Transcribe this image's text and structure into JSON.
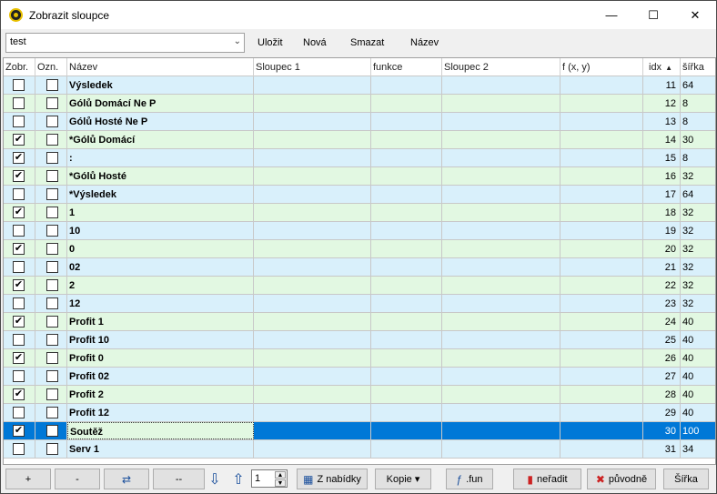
{
  "window": {
    "title": "Zobrazit sloupce",
    "minimize": "—",
    "maximize": "☐",
    "close": "✕"
  },
  "toolbar": {
    "combo_value": "test",
    "save_label": "Uložit",
    "new_label": "Nová",
    "delete_label": "Smazat",
    "name_label": "Název"
  },
  "grid": {
    "columns": [
      "Zobr.",
      "Ozn.",
      "Název",
      "Sloupec 1",
      "funkce",
      "Sloupec 2",
      "f (x, y)",
      "idx",
      "šířka"
    ],
    "sort_indicator": "▲",
    "rows": [
      {
        "show": false,
        "mark": false,
        "name": "Výsledek",
        "idx": "11",
        "width": "64"
      },
      {
        "show": false,
        "mark": false,
        "name": "Gólů Domácí Ne P",
        "idx": "12",
        "width": "8"
      },
      {
        "show": false,
        "mark": false,
        "name": "Gólů Hosté Ne P",
        "idx": "13",
        "width": "8"
      },
      {
        "show": true,
        "mark": false,
        "name": "*Gólů Domácí",
        "idx": "14",
        "width": "30"
      },
      {
        "show": true,
        "mark": false,
        "name": ":",
        "idx": "15",
        "width": "8"
      },
      {
        "show": true,
        "mark": false,
        "name": "*Gólů Hosté",
        "idx": "16",
        "width": "32"
      },
      {
        "show": false,
        "mark": false,
        "name": "*Výsledek",
        "idx": "17",
        "width": "64"
      },
      {
        "show": true,
        "mark": false,
        "name": "1",
        "idx": "18",
        "width": "32"
      },
      {
        "show": false,
        "mark": false,
        "name": "10",
        "idx": "19",
        "width": "32"
      },
      {
        "show": true,
        "mark": false,
        "name": "0",
        "idx": "20",
        "width": "32"
      },
      {
        "show": false,
        "mark": false,
        "name": "02",
        "idx": "21",
        "width": "32"
      },
      {
        "show": true,
        "mark": false,
        "name": "2",
        "idx": "22",
        "width": "32"
      },
      {
        "show": false,
        "mark": false,
        "name": "12",
        "idx": "23",
        "width": "32"
      },
      {
        "show": true,
        "mark": false,
        "name": "Profit 1",
        "idx": "24",
        "width": "40"
      },
      {
        "show": false,
        "mark": false,
        "name": "Profit 10",
        "idx": "25",
        "width": "40"
      },
      {
        "show": true,
        "mark": false,
        "name": "Profit 0",
        "idx": "26",
        "width": "40"
      },
      {
        "show": false,
        "mark": false,
        "name": "Profit 02",
        "idx": "27",
        "width": "40"
      },
      {
        "show": true,
        "mark": false,
        "name": "Profit 2",
        "idx": "28",
        "width": "40"
      },
      {
        "show": false,
        "mark": false,
        "name": "Profit 12",
        "idx": "29",
        "width": "40"
      },
      {
        "show": true,
        "mark": false,
        "name": "Soutěž",
        "idx": "30",
        "width": "100",
        "selected": true
      },
      {
        "show": false,
        "mark": false,
        "name": "Serv 1",
        "idx": "31",
        "width": "34"
      }
    ]
  },
  "bottom": {
    "add_label": "+",
    "remove_label": "-",
    "dashes_label": "--",
    "spinner_value": "1",
    "from_menu_label": "Z nabídky",
    "copy_label": "Kopie ▾",
    "fun_label": ".fun",
    "unsort_label": "neřadit",
    "original_label": "původně",
    "width_label": "Šířka",
    "refresh_icon": "refresh-icon",
    "down_icon": "arrow-down-icon",
    "up_icon": "arrow-up-icon"
  },
  "colors": {
    "row_blue": "#d9f0fb",
    "row_green": "#e2f8e2",
    "selection": "#0078d7"
  }
}
